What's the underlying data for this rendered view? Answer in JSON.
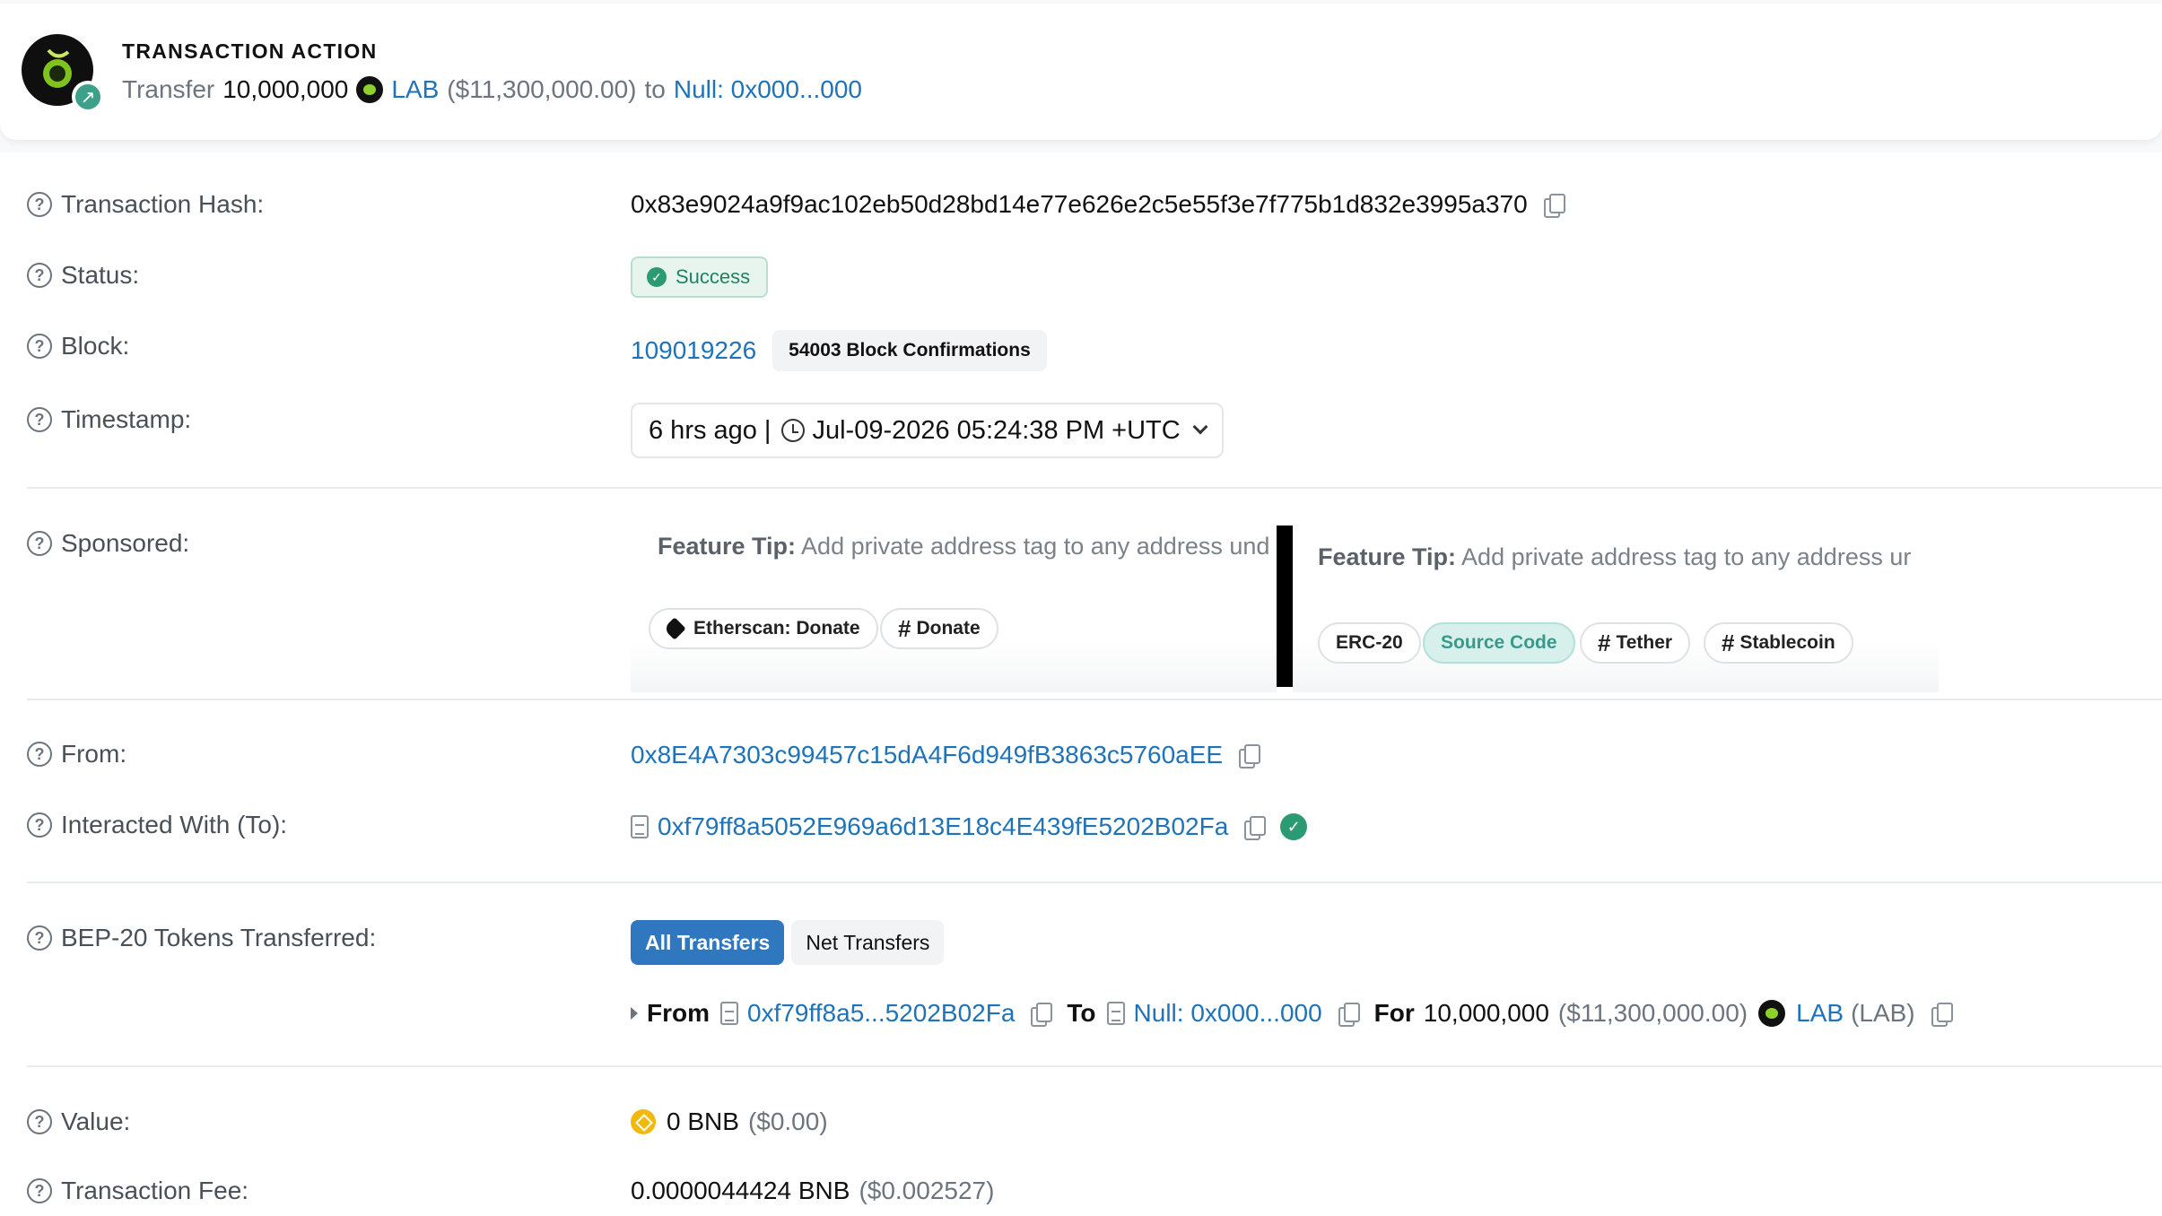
{
  "header": {
    "title": "TRANSACTION ACTION",
    "action_word": "Transfer",
    "amount": "10,000,000",
    "token": "LAB",
    "usd": "($11,300,000.00)",
    "to_word": "to",
    "to_address": "Null: 0x000...000"
  },
  "rows": {
    "hash": {
      "label": "Transaction Hash:",
      "value": "0x83e9024a9f9ac102eb50d28bd14e77e626e2c5e55f3e7f775b1d832e3995a370"
    },
    "status": {
      "label": "Status:",
      "value": "Success"
    },
    "block": {
      "label": "Block:",
      "number": "109019226",
      "confirmations": "54003 Block Confirmations"
    },
    "timestamp": {
      "label": "Timestamp:",
      "ago": "6 hrs ago",
      "sep": "|",
      "datetime": "Jul-09-2026 05:24:38 PM +UTC"
    },
    "sponsored": {
      "label": "Sponsored:",
      "left": {
        "tip_bold": "Feature Tip:",
        "tip_text": "Add private address tag to any address und",
        "pills": [
          "Etherscan: Donate",
          "Donate"
        ]
      },
      "right": {
        "tip_bold": "Feature Tip:",
        "tip_text": "Add private address tag to any address ur",
        "pills": [
          "ERC-20",
          "Source Code",
          "Tether",
          "Stablecoin"
        ]
      }
    },
    "from": {
      "label": "From:",
      "value": "0x8E4A7303c99457c15dA4F6d949fB3863c5760aEE"
    },
    "to": {
      "label": "Interacted With (To):",
      "value": "0xf79ff8a5052E969a6d13E18c4E439fE5202B02Fa"
    },
    "tokens": {
      "label": "BEP-20 Tokens Transferred:",
      "tab_all": "All Transfers",
      "tab_net": "Net Transfers",
      "transfer": {
        "from_word": "From",
        "from_addr": "0xf79ff8a5...5202B02Fa",
        "to_word": "To",
        "to_addr": "Null: 0x000...000",
        "for_word": "For",
        "amount": "10,000,000",
        "usd": "($11,300,000.00)",
        "token": "LAB",
        "token_symbol": "(LAB)"
      }
    },
    "value": {
      "label": "Value:",
      "amount": "0 BNB",
      "usd": "($0.00)"
    },
    "fee": {
      "label": "Transaction Fee:",
      "amount": "0.0000044424 BNB",
      "usd": "($0.002527)"
    }
  },
  "hash_glyph": "#",
  "colors": {
    "link": "#1f73b8",
    "success": "#2c9b74",
    "tab_active": "#2f78c0",
    "teal_pill": "#d7f0ec"
  }
}
